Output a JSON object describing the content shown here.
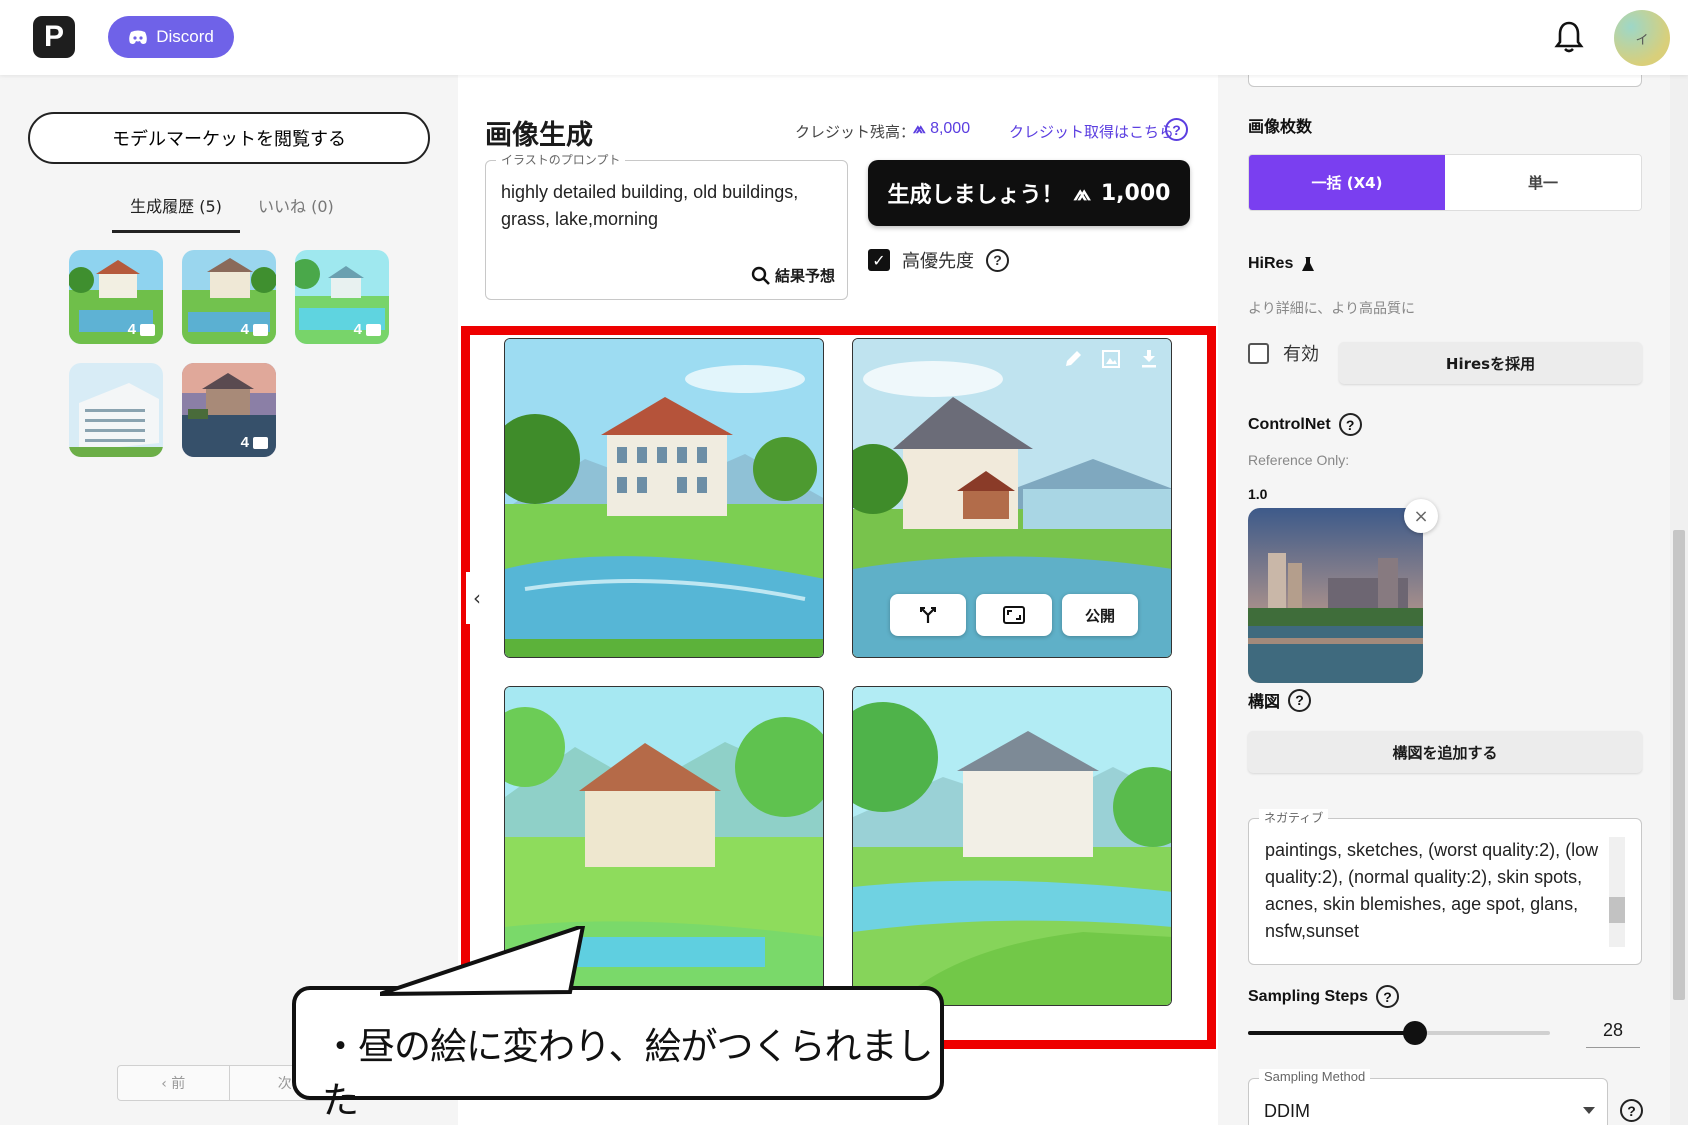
{
  "header": {
    "logo_letter": "P",
    "discord_label": "Discord",
    "avatar_initial": "イ"
  },
  "left": {
    "market_button": "モデルマーケットを閲覧する",
    "tabs": [
      {
        "label": "生成履歴 (5)",
        "active": true
      },
      {
        "label": "いいね (0)",
        "active": false
      }
    ],
    "history": [
      {
        "count": "4",
        "scene": "day-lake"
      },
      {
        "count": "4",
        "scene": "day-lake"
      },
      {
        "count": "4",
        "scene": "bright-lake"
      },
      {
        "count": "",
        "scene": "modern-building"
      },
      {
        "count": "4",
        "scene": "dusk-lake"
      }
    ],
    "pager": {
      "prev": "‹  前",
      "next": "次"
    }
  },
  "center": {
    "title": "画像生成",
    "credit_label": "クレジット残高：",
    "credit_value": "8,000",
    "credit_link": "クレジット取得はこちら",
    "prompt_legend": "イラストのプロンプト",
    "prompt_text": "highly detailed building, old buildings, grass, lake,morning",
    "predict_label": "結果予想",
    "generate_label": "生成しましょう！",
    "generate_cost": "1,000",
    "priority_label": "高優先度",
    "priority_checked": true,
    "image_actions": {
      "branch": "branch-icon",
      "expand": "expand-icon",
      "publish": "公開"
    },
    "callout_text": "・昼の絵に変わり、絵がつくられました"
  },
  "right": {
    "image_count_label": "画像枚数",
    "image_count_options": [
      "一括 (X4)",
      "単一"
    ],
    "hires_label": "HiRes",
    "hires_sub": "より詳細に、より高品質に",
    "hires_enable_label": "有効",
    "hires_adopt_button": "Hiresを採用",
    "controlnet_label": "ControlNet",
    "reference_label": "Reference Only:",
    "reference_weight": "1.0",
    "composition_label": "構図",
    "composition_button": "構図を追加する",
    "negative_legend": "ネガティブ",
    "negative_text": "paintings, sketches, (worst quality:2), (low quality:2), (normal quality:2), skin spots, acnes, skin blemishes, age spot, glans, nsfw,sunset",
    "sampling_steps_label": "Sampling Steps",
    "sampling_steps_value": "28",
    "sampling_method_legend": "Sampling Method",
    "sampling_method_value": "DDIM"
  },
  "colors": {
    "accent": "#7a3ff0",
    "discord": "#6f62e8",
    "highlight_frame": "#ee0000"
  }
}
